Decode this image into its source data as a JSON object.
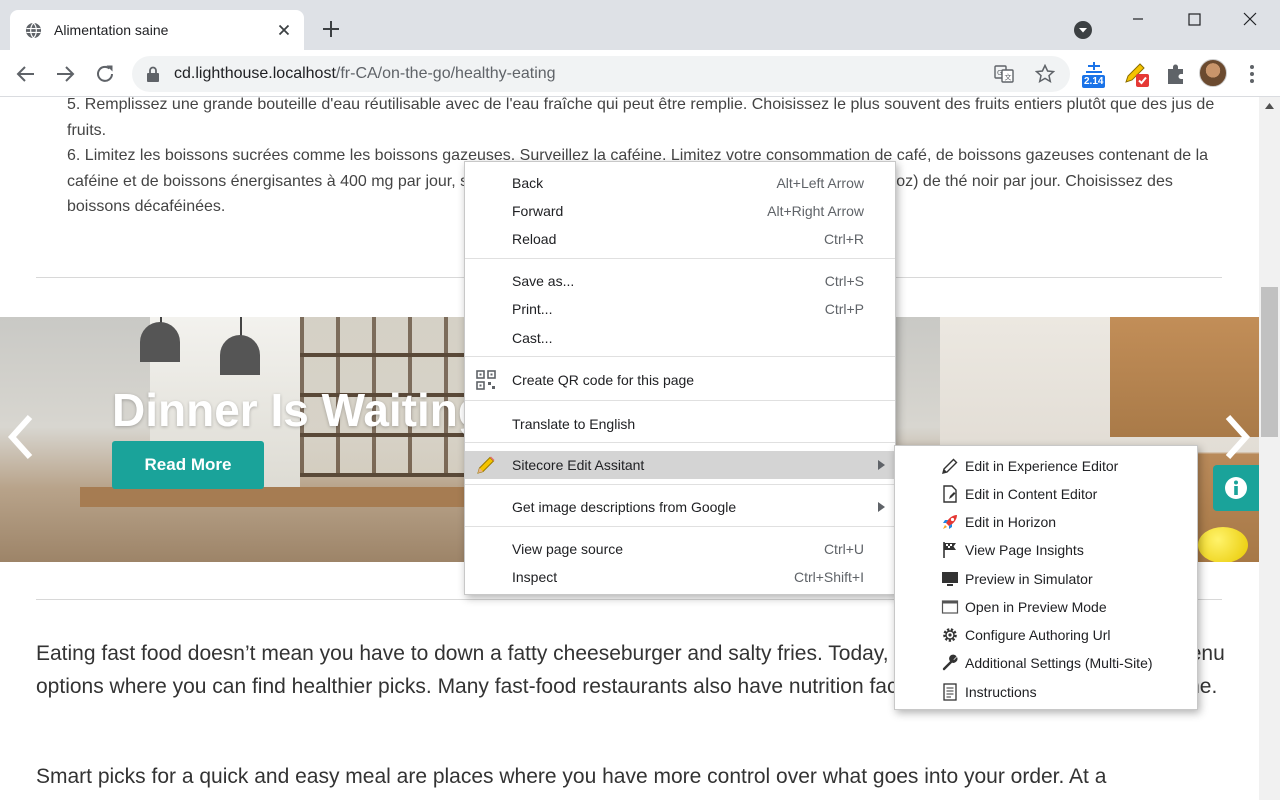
{
  "browser": {
    "tab_title": "Alimentation saine",
    "url_host": "cd.lighthouse.localhost",
    "url_path": "/fr-CA/on-the-go/healthy-eating",
    "extension_badge": "2.14"
  },
  "page": {
    "list_items": [
      "5. Remplissez une grande bouteille d'eau réutilisable avec de l'eau fraîche qui peut être remplie. Choisissez le plus souvent des fruits entiers plutôt que des jus de fruits.",
      "6. Limitez les boissons sucrées comme les boissons gazeuses. Surveillez la caféine. Limitez votre consommation de café, de boissons gazeuses contenant de la caféine et de boissons énergisantes à 400 mg par jour, soit environ 3 tasses de café ordinaire ou 8 tasses (2 L ou 64 oz) de thé noir par jour. Choisissez des boissons décaféinées."
    ],
    "banner_title": "Dinner Is Waiting",
    "banner_button": "Read More",
    "paragraph1": "Eating fast food doesn’t mean you have to down a fatty cheeseburger and salty fries. Today, most chains have a variety of menu options where you can find healthier picks. Many fast-food restaurants also have nutrition facts, including calorie counts, online.",
    "paragraph2": "Smart picks for a quick and easy meal are places where you have more control over what goes into your order. At a"
  },
  "context_menu": {
    "groups": [
      [
        {
          "label": "Back",
          "shortcut": "Alt+Left Arrow"
        },
        {
          "label": "Forward",
          "shortcut": "Alt+Right Arrow"
        },
        {
          "label": "Reload",
          "shortcut": "Ctrl+R"
        }
      ],
      [
        {
          "label": "Save as...",
          "shortcut": "Ctrl+S"
        },
        {
          "label": "Print...",
          "shortcut": "Ctrl+P"
        },
        {
          "label": "Cast...",
          "shortcut": ""
        }
      ],
      [
        {
          "label": "Create QR code for this page",
          "shortcut": "",
          "icon": "qr-code-icon"
        }
      ],
      [
        {
          "label": "Translate to English",
          "shortcut": ""
        }
      ],
      [
        {
          "label": "Sitecore Edit Assitant",
          "shortcut": "",
          "icon": "pencil-icon",
          "submenu": true,
          "highlighted": true
        }
      ],
      [
        {
          "label": "Get image descriptions from Google",
          "shortcut": "",
          "submenu": true
        }
      ],
      [
        {
          "label": "View page source",
          "shortcut": "Ctrl+U"
        },
        {
          "label": "Inspect",
          "shortcut": "Ctrl+Shift+I"
        }
      ]
    ]
  },
  "submenu": {
    "items": [
      {
        "label": "Edit in Experience Editor",
        "icon": "pencil-edit-icon"
      },
      {
        "label": "Edit in Content Editor",
        "icon": "document-edit-icon"
      },
      {
        "label": "Edit in Horizon",
        "icon": "rocket-icon"
      },
      {
        "label": "View Page Insights",
        "icon": "flag-icon"
      },
      {
        "label": "Preview in Simulator",
        "icon": "monitor-icon"
      },
      {
        "label": "Open in Preview Mode",
        "icon": "window-icon"
      },
      {
        "label": "Configure Authoring Url",
        "icon": "gear-icon"
      },
      {
        "label": "Additional Settings (Multi-Site)",
        "icon": "wrench-icon"
      },
      {
        "label": "Instructions",
        "icon": "document-icon"
      }
    ]
  },
  "colors": {
    "accent_teal": "#1aa39a",
    "menu_highlight": "#d4d4d4",
    "tabbar": "#dee1e6"
  }
}
